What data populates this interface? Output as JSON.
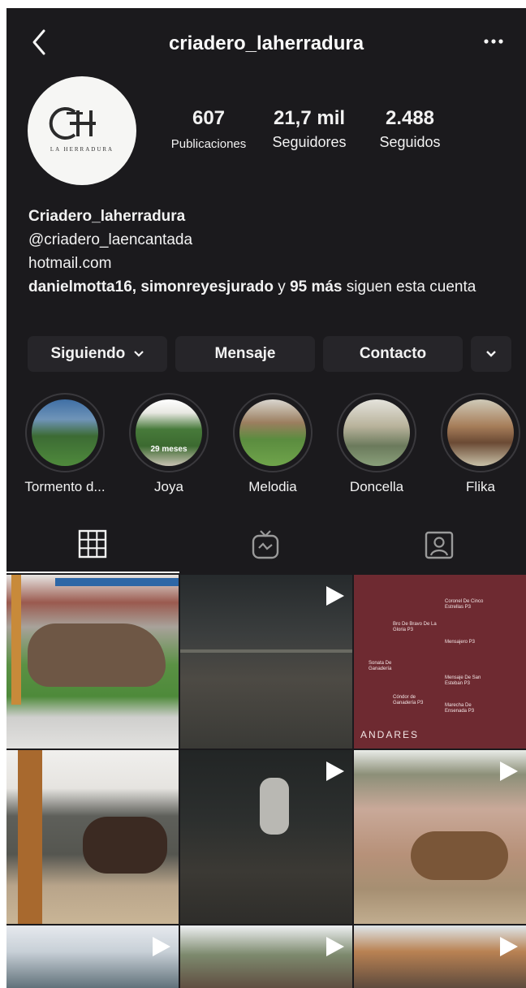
{
  "header": {
    "title": "criadero_laherradura",
    "back_icon": "chevron-left-icon",
    "more_icon": "more-horizontal-icon"
  },
  "profile": {
    "avatar_word": "LA HERRADURA",
    "stats": [
      {
        "value": "607",
        "label": "Publicaciones"
      },
      {
        "value": "21,7 mil",
        "label": "Seguidores"
      },
      {
        "value": "2.488",
        "label": "Seguidos"
      }
    ]
  },
  "bio": {
    "name": "Criadero_laherradura",
    "handle": "@criadero_laencantada",
    "email": "hotmail.com",
    "followed_users": "danielmotta16, simonreyesjurado",
    "followed_joiner": " y ",
    "followed_count": "95 más",
    "followed_suffix": " siguen esta cuenta"
  },
  "buttons": {
    "following": "Siguiendo",
    "message": "Mensaje",
    "contact": "Contacto",
    "more_icon": "chevron-down-icon"
  },
  "highlights": [
    {
      "label": "Tormento d..."
    },
    {
      "label": "Joya",
      "overlay": "29 meses"
    },
    {
      "label": "Melodia"
    },
    {
      "label": "Doncella"
    },
    {
      "label": "Flika"
    }
  ],
  "tabs": [
    {
      "name": "grid",
      "icon": "grid-icon",
      "active": true
    },
    {
      "name": "igtv",
      "icon": "igtv-icon",
      "active": false
    },
    {
      "name": "tagged",
      "icon": "tagged-person-icon",
      "active": false
    }
  ],
  "posts": [
    {
      "kind": "photo",
      "video": false
    },
    {
      "kind": "video",
      "video": true
    },
    {
      "kind": "graphic",
      "video": false,
      "footer": "ANDARES",
      "tags": [
        "Bro De Bravo De La Gloria P3",
        "Coronel De Cinco Estrellas P3",
        "Sonata De Ganadería",
        "Mensajero P3",
        "Cóndor de Ganadería P3",
        "Mensaje De San Esteban P3",
        "Marecha De Ensenada P3"
      ]
    },
    {
      "kind": "photo",
      "video": false
    },
    {
      "kind": "video",
      "video": true
    },
    {
      "kind": "photo",
      "video": false
    },
    {
      "kind": "photo",
      "video": true
    },
    {
      "kind": "photo",
      "video": true
    },
    {
      "kind": "photo",
      "video": true
    }
  ],
  "colors": {
    "background": "#1b1a1d",
    "button": "#262529",
    "graphic_post": "#6e2a31"
  }
}
